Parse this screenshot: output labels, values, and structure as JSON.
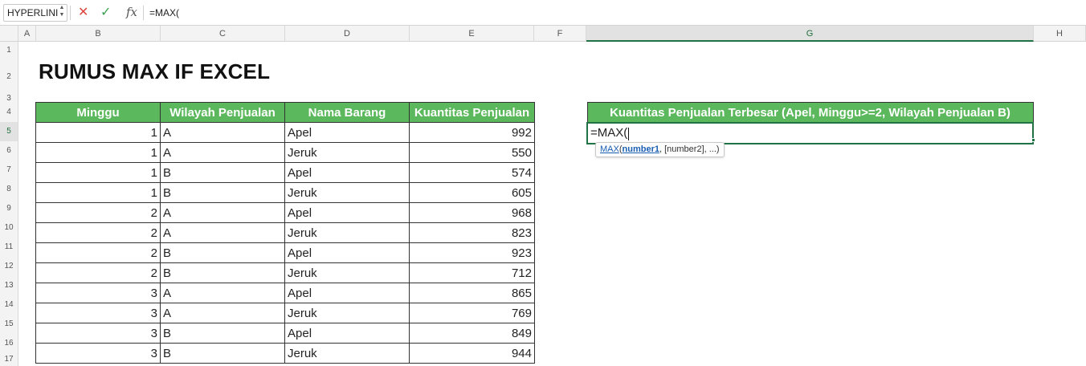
{
  "formula_bar": {
    "name_box": "HYPERLINI",
    "cancel_icon": "close-icon",
    "confirm_icon": "check-icon",
    "fx_label": "fx",
    "formula": "=MAX("
  },
  "columns": [
    "A",
    "B",
    "C",
    "D",
    "E",
    "F",
    "G",
    "H"
  ],
  "rows": [
    "1",
    "2",
    "3",
    "4",
    "5",
    "6",
    "7",
    "8",
    "9",
    "10",
    "11",
    "12",
    "13",
    "14",
    "15",
    "16",
    "17"
  ],
  "title": "RUMUS MAX IF EXCEL",
  "data_table": {
    "headers": [
      "Minggu",
      "Wilayah Penjualan",
      "Nama Barang",
      "Kuantitas Penjualan"
    ],
    "rows": [
      [
        "1",
        "A",
        "Apel",
        "992"
      ],
      [
        "1",
        "A",
        "Jeruk",
        "550"
      ],
      [
        "1",
        "B",
        "Apel",
        "574"
      ],
      [
        "1",
        "B",
        "Jeruk",
        "605"
      ],
      [
        "2",
        "A",
        "Apel",
        "968"
      ],
      [
        "2",
        "A",
        "Jeruk",
        "823"
      ],
      [
        "2",
        "B",
        "Apel",
        "923"
      ],
      [
        "2",
        "B",
        "Jeruk",
        "712"
      ],
      [
        "3",
        "A",
        "Apel",
        "865"
      ],
      [
        "3",
        "A",
        "Jeruk",
        "769"
      ],
      [
        "3",
        "B",
        "Apel",
        "849"
      ],
      [
        "3",
        "B",
        "Jeruk",
        "944"
      ]
    ]
  },
  "result": {
    "header": "Kuantitas Penjualan Terbesar (Apel, Minggu>=2, Wilayah Penjualan B)",
    "cell_value": "=MAX("
  },
  "tooltip": {
    "function": "MAX",
    "open": "(",
    "arg1": "number1",
    "rest": ", [number2], ...)"
  },
  "colors": {
    "header_green": "#5cb85c",
    "selection_green": "#217346"
  }
}
